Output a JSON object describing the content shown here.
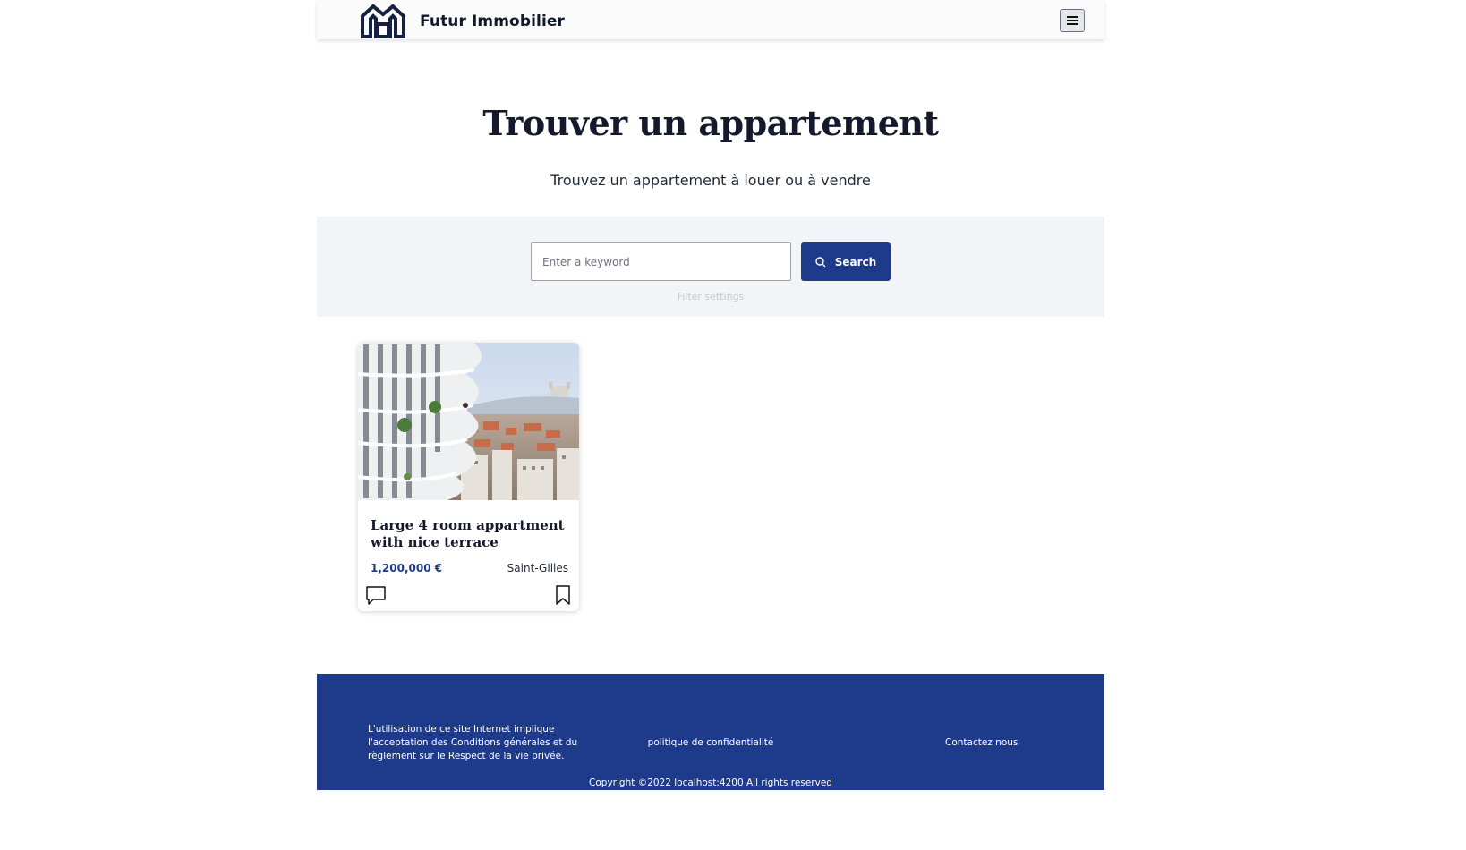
{
  "header": {
    "brand": "Futur Immobilier",
    "logo_icon": "house-outline-icon",
    "menu_icon": "hamburger-menu-icon"
  },
  "hero": {
    "title": "Trouver un appartement",
    "subtitle": "Trouvez un appartement à louer ou à vendre"
  },
  "search": {
    "placeholder": "Enter a keyword",
    "value": "",
    "button_label": "Search",
    "button_icon": "search-icon",
    "filter_label": "Filter settings"
  },
  "listings": [
    {
      "title": "Large 4 room appartment with nice terrace",
      "price": "1,200,000 €",
      "location": "Saint-Gilles",
      "image": "apartment-balcony-city-view",
      "comment_icon": "comment-icon",
      "bookmark_icon": "bookmark-icon"
    }
  ],
  "footer": {
    "terms": "L'utilisation de ce site Internet implique l'acceptation des Conditions générales et du règlement sur le Respect de la vie privée.",
    "privacy_link": "politique de confidentialité",
    "contact_link": "Contactez nous",
    "copyright": "Copyright ©2022 localhost:4200 All rights reserved"
  },
  "colors": {
    "primary": "#1e3a8a",
    "search_band": "#f3f4f7",
    "heading": "#141a2c"
  }
}
